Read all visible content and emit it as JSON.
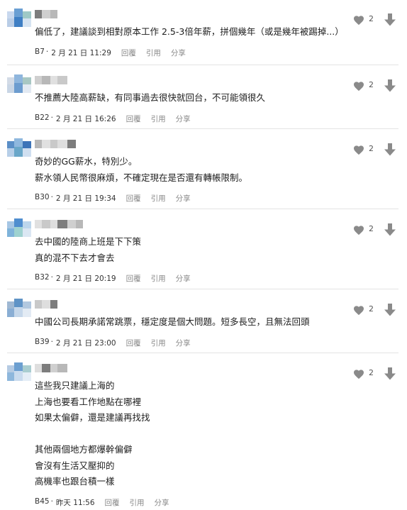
{
  "labels": {
    "reply": "回覆",
    "quote": "引用",
    "share": "分享"
  },
  "icons": {
    "like": "heart-icon",
    "dislike": "down-arrow-icon"
  },
  "colors": {
    "icon": "#8a8a8a",
    "divider": "#e3e3e3",
    "avatar_blue": "#5b9bd5",
    "avatar_teal": "#7ec8c8"
  },
  "comments": [
    {
      "floor": "B7",
      "time": "2 月 21 日 11:29",
      "likes": "2",
      "lines": [
        "偏低了，建議談到相對原本工作 2.5-3倍年薪，拼個幾年（或是幾年被踢掉...）"
      ]
    },
    {
      "floor": "B22",
      "time": "2 月 21 日 16:26",
      "likes": "2",
      "lines": [
        "不推薦大陸高薪缺，有同事過去很快就回台，不可能領很久"
      ]
    },
    {
      "floor": "B30",
      "time": "2 月 21 日 19:34",
      "likes": "2",
      "lines": [
        "奇妙的GG薪水，特別少。",
        "薪水領人民幣很麻煩，不確定現在是否還有轉帳限制。"
      ]
    },
    {
      "floor": "B32",
      "time": "2 月 21 日 20:19",
      "likes": "2",
      "lines": [
        "去中國的陸商上班是下下策",
        "真的混不下去才會去"
      ]
    },
    {
      "floor": "B39",
      "time": "2 月 21 日 23:00",
      "likes": "2",
      "lines": [
        "中國公司長期承諾常跳票，穩定度是個大問題。短多長空，且無法回頭"
      ]
    },
    {
      "floor": "B45",
      "time": "昨天 11:56",
      "likes": "2",
      "lines": [
        "這些我只建議上海的",
        "上海也要看工作地點在哪裡",
        "如果太偏僻，還是建議再找找",
        "",
        "其他兩個地方都爆幹偏僻",
        "會沒有生活又壓抑的",
        "高機率也跟台積一樣"
      ]
    }
  ]
}
